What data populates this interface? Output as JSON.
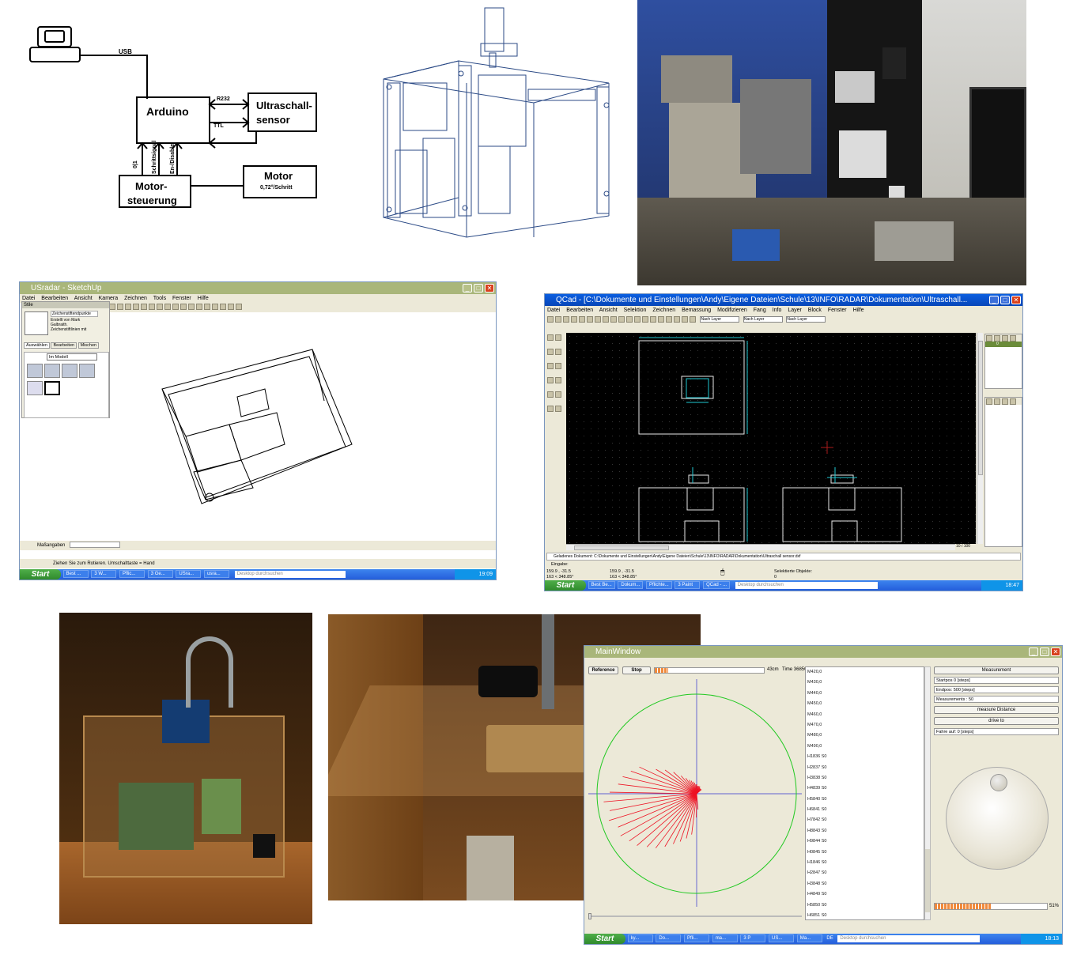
{
  "block_diagram": {
    "usb": "USB",
    "arduino": "Arduino",
    "r232": "R232",
    "ttl": "TTL",
    "sensor_line1": "Ultraschall-",
    "sensor_line2": "sensor",
    "motor": "Motor",
    "motor_spec": "0,72°/Schritt",
    "ctrl_line1": "Motor-",
    "ctrl_line2": "steuerung",
    "sig1": "0|1",
    "sig2": "Schrittsignal",
    "sig3": "En-/Disable"
  },
  "sketchup": {
    "title": "USradar - SketchUp",
    "menu": [
      "Datei",
      "Bearbeiten",
      "Ansicht",
      "Kamera",
      "Zeichnen",
      "Tools",
      "Fenster",
      "Hilfe"
    ],
    "panel_title": "Stile",
    "panel_desc": [
      "Zeichenstiftendpunkte",
      "Erstellt von Mark",
      "Galbraith.",
      "Zeichenstiftlinien mit"
    ],
    "tabs": [
      "Auswählen",
      "Bearbeiten",
      "Mischen"
    ],
    "dropdown": "Im Modell",
    "measure_label": "Maßangaben",
    "status": "Ziehen Sie zum Rotieren. Umschalttaste = Hand",
    "taskbar": {
      "start": "Start",
      "tasks": [
        "Best ...",
        "3 W...",
        "Pflic...",
        "3 Ge...",
        "USra...",
        "usra..."
      ],
      "search": "Desktop durchsuchen",
      "time": "19:09"
    }
  },
  "qcad": {
    "title": "QCad - [C:\\Dokumente und Einstellungen\\Andy\\Eigene Dateien\\Schule\\13\\INFO\\RADAR\\Dokumentation\\Ultraschall...",
    "menu": [
      "Datei",
      "Bearbeiten",
      "Ansicht",
      "Selektion",
      "Zeichnen",
      "Bemassung",
      "Modifizieren",
      "Fang",
      "Info",
      "Layer",
      "Block",
      "Fenster",
      "Hilfe"
    ],
    "layer_dd": [
      "Nach Layer",
      "Nach Layer",
      "Nach Layer"
    ],
    "command_log": "Geladenes Dokument: C:\\Dokumente und Einstellungen\\Andy\\Eigene Dateien\\Schule\\13\\INFO\\RADAR\\Dokumentation\\Ultraschall sensor.dxf",
    "input_label": "Eingabe:",
    "coord1a": "159.9 , -31.5",
    "coord1b": "163 < 348.85°",
    "coord2a": "159.9 , -31.5",
    "coord2b": "163 < 348.85°",
    "selected_label": "Selektierte Objekte:",
    "selected_count": "0",
    "page": "10 / 100",
    "layer_item": "0",
    "taskbar": {
      "start": "Start",
      "tasks": [
        "Best Be...",
        "Dokum...",
        "Pflichte...",
        "3 Paint",
        "QCad - ..."
      ],
      "search": "Desktop durchsuchen",
      "time": "18:47"
    }
  },
  "mainwindow": {
    "title": "MainWindow",
    "reference_btn": "Reference",
    "stop_btn": "Stop",
    "distance": "43cm",
    "time": "Time 36850",
    "progress_top": 0.12,
    "list": [
      "M420,0",
      "M430,0",
      "M440,0",
      "M450,0",
      "M460,0",
      "M470,0",
      "M480,0",
      "M490,0",
      "H1836 S0",
      "H2837 S0",
      "H3838 S0",
      "H4839 S0",
      "H5840 S0",
      "H6841 S0",
      "H7842 S0",
      "H8843 S0",
      "H9844 S0",
      "H0845 S0",
      "H1846 S0",
      "H2847 S0",
      "H3848 S0",
      "H4849 S0",
      "H5850 S0",
      "H6851 S0"
    ],
    "measurement_btn": "Measurement",
    "startpos": "Startpos 0  [steps]",
    "endpos": "Endpos:  500  [steps]",
    "measurements": "Measurements : 50",
    "measure_distance_btn": "measure Distance",
    "drive_to_btn": "drive to",
    "fahre_auf": "Fahre auf: 0 [steps]",
    "progress_pct": "51%",
    "progress_value": 0.51,
    "taskbar": {
      "start": "Start",
      "tasks": [
        "ky...",
        "Do...",
        "Pfli...",
        "ma...",
        "3 P",
        "US...",
        "Ma..."
      ],
      "lang": "DE",
      "search": "Desktop durchsuchen",
      "time": "18:13"
    }
  },
  "colors": {
    "xp_blue": "#0a4fd6",
    "olive_title": "#a9b67a",
    "qcad_canvas": "#000000",
    "qcad_lines": "#e8e8e8",
    "qcad_cyan": "#21c9d2",
    "radar_red": "#ee1122",
    "radar_green": "#22c922",
    "radar_axis": "#3333cc",
    "progress_orange": "#f08a3c"
  }
}
